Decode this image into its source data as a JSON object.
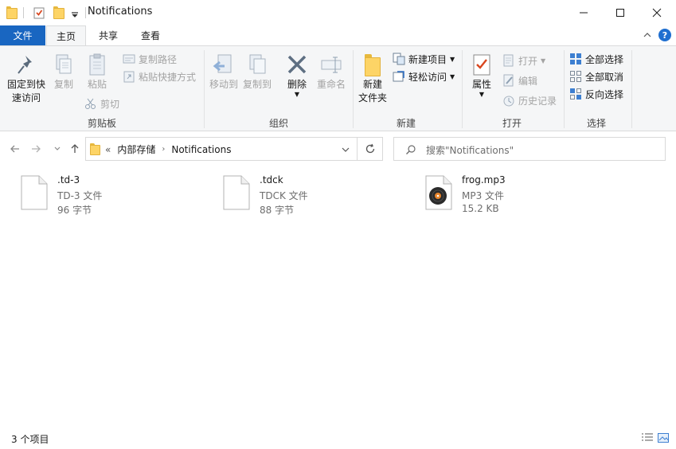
{
  "window": {
    "title": "Notifications",
    "controls": [
      "minimize",
      "maximize",
      "close"
    ]
  },
  "ribbon_tabs": {
    "file": "文件",
    "home": "主页",
    "share": "共享",
    "view": "查看"
  },
  "ribbon": {
    "clipboard": {
      "label": "剪贴板",
      "pin": "固定到快\n速访问",
      "pin_line1": "固定到快",
      "pin_line2": "速访问",
      "copy": "复制",
      "paste": "粘贴",
      "copy_path": "复制路径",
      "paste_shortcut": "粘贴快捷方式",
      "cut": "剪切"
    },
    "organize": {
      "label": "组织",
      "move_to": "移动到",
      "copy_to": "复制到",
      "delete": "删除",
      "rename": "重命名"
    },
    "new": {
      "label": "新建",
      "new_folder_line1": "新建",
      "new_folder_line2": "文件夹",
      "new_item": "新建项目",
      "easy_access": "轻松访问"
    },
    "open": {
      "label": "打开",
      "properties": "属性",
      "open": "打开",
      "edit": "编辑",
      "history": "历史记录"
    },
    "select": {
      "label": "选择",
      "select_all": "全部选择",
      "select_none": "全部取消",
      "invert": "反向选择"
    }
  },
  "address": {
    "overflow": "«",
    "crumbs": [
      "内部存储",
      "Notifications"
    ]
  },
  "search": {
    "placeholder": "搜索\"Notifications\""
  },
  "files": [
    {
      "name": ".td-3",
      "type": "TD-3 文件",
      "size": "96 字节",
      "icon": "blank-document-icon"
    },
    {
      "name": ".tdck",
      "type": "TDCK 文件",
      "size": "88 字节",
      "icon": "blank-document-icon"
    },
    {
      "name": "frog.mp3",
      "type": "MP3 文件",
      "size": "15.2 KB",
      "icon": "music-disc-icon"
    }
  ],
  "status": {
    "count": "3 个项目"
  },
  "colors": {
    "accent": "#1966c1",
    "folder": "#fdd466",
    "ribbon_bg": "#f5f6f7"
  }
}
